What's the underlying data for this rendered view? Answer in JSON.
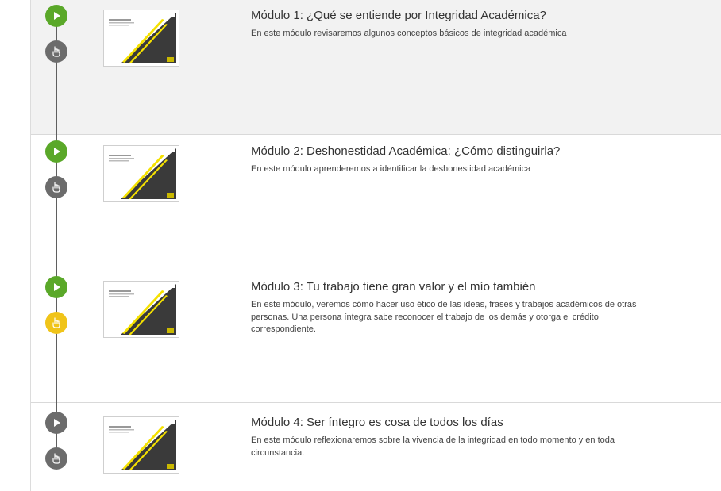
{
  "modules": [
    {
      "title": "Módulo 1: ¿Qué se entiende por Integridad Académica?",
      "description": "En este módulo revisaremos algunos conceptos básicos de integridad académica",
      "play_state": "active",
      "activity_state": "default",
      "thumbnail": {
        "label": "Módulo I"
      }
    },
    {
      "title": "Módulo 2: Deshonestidad Académica: ¿Cómo distinguirla?",
      "description": "En este módulo aprenderemos a identificar la deshonestidad académica",
      "play_state": "active",
      "activity_state": "default",
      "thumbnail": {
        "label": "Módulo II"
      }
    },
    {
      "title": "Módulo 3: Tu trabajo tiene gran valor y el mío también",
      "description": "En este módulo, veremos cómo hacer uso ético de las ideas, frases y trabajos académicos de otras personas. Una persona íntegra sabe reconocer el trabajo de los demás y otorga el crédito correspondiente.",
      "play_state": "active",
      "activity_state": "highlighted",
      "thumbnail": {
        "label": "Módulo III"
      }
    },
    {
      "title": "Módulo 4: Ser íntegro es cosa de todos los días",
      "description": "En este módulo reflexionaremos sobre la vivencia de la integridad en todo momento y en toda circunstancia.",
      "play_state": "inactive",
      "activity_state": "default",
      "thumbnail": {
        "label": "Módulo IV"
      }
    }
  ],
  "colors": {
    "play_active": "#5aa829",
    "play_inactive": "#6c6c6c",
    "activity_default": "#6c6c6c",
    "activity_highlight": "#f0c419",
    "timeline": "#5f5f5f",
    "first_row_bg": "#f2f2f2"
  },
  "icons": {
    "play": "play-icon",
    "activity": "touch-hand-icon"
  }
}
